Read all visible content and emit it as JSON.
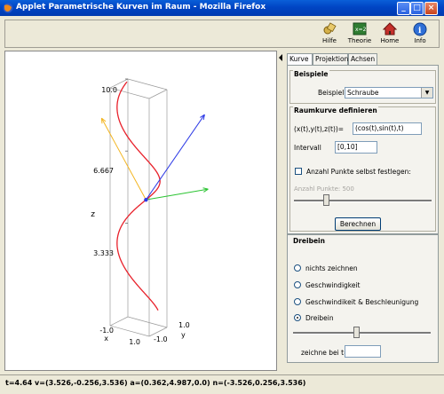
{
  "window": {
    "title": "Applet Parametrische Kurven im Raum - Mozilla Firefox",
    "min_label": "_",
    "max_label": "□",
    "close_label": "×"
  },
  "toolbar": {
    "items": [
      {
        "label": "Hilfe",
        "icon": "help-icon"
      },
      {
        "label": "Theorie",
        "icon": "theory-icon"
      },
      {
        "label": "Home",
        "icon": "home-icon"
      },
      {
        "label": "Info",
        "icon": "info-icon"
      }
    ]
  },
  "plot": {
    "z_label": "z",
    "z_ticks": [
      "10.0",
      "6.667",
      "3.333",
      "-1.0"
    ],
    "x_label": "x",
    "x_ticks": [
      "-1.0",
      "1.0"
    ],
    "y_label": "y",
    "y_ticks": [
      "1.0",
      "-1.0"
    ],
    "colors": {
      "curve": "#e8202a",
      "tangent": "#2d3ae6",
      "normal": "#2bc432",
      "binormal": "#f3b520",
      "box": "#9a9a9a"
    }
  },
  "panel": {
    "tabs": [
      {
        "label": "Kurve",
        "active": true
      },
      {
        "label": "Projektion",
        "active": false
      },
      {
        "label": "Achsen",
        "active": false
      }
    ],
    "beispiele": {
      "title": "Beispiele",
      "label": "Beispiel",
      "value": "Schraube"
    },
    "raumkurve": {
      "title": "Raumkurve definieren",
      "func_label": "(x(t),y(t),z(t))=",
      "func_value": "(cos(t),sin(t),t)",
      "interval_label": "Intervall",
      "interval_value": "[0,10]",
      "checkbox_label": "Anzahl Punkte selbst festlegen:",
      "checkbox_checked": false,
      "points_label": "Anzahl Punkte: 500",
      "points_level": 0.22,
      "button_label": "Berechnen"
    },
    "dreibein": {
      "title": "Dreibein",
      "options": [
        {
          "label": "nichts zeichnen",
          "selected": false
        },
        {
          "label": "Geschwindigkeit",
          "selected": false
        },
        {
          "label": "Geschwindikeit & Beschleunigung",
          "selected": false
        },
        {
          "label": "Dreibein",
          "selected": true
        }
      ],
      "slider_level": 0.46,
      "zeichne_label": "zeichne bei t=",
      "zeichne_value": ""
    }
  },
  "status": {
    "text": "t=4.64 v=(3.526,-0.256,3.536)  a=(0.362,4.987,0.0)  n=(-3.526,0.256,3.536)"
  }
}
